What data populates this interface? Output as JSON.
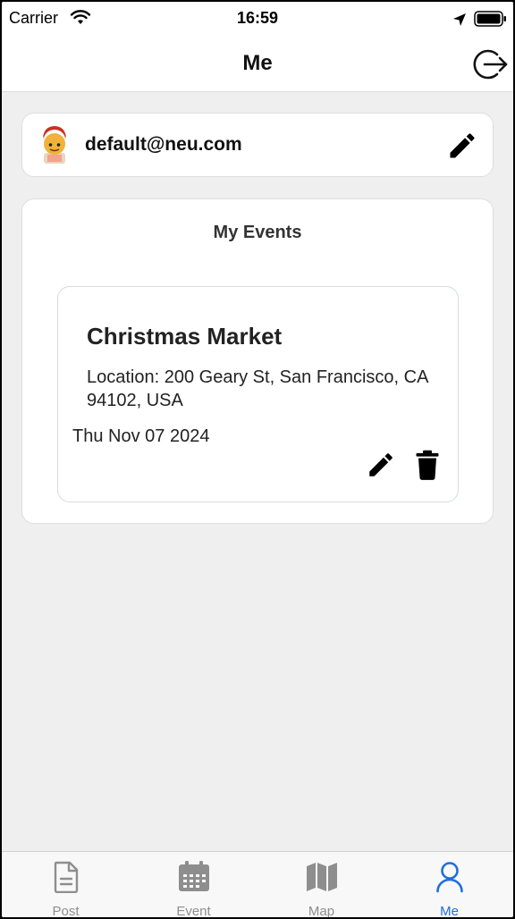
{
  "status_bar": {
    "carrier": "Carrier",
    "time": "16:59"
  },
  "nav": {
    "title": "Me",
    "logout_icon": "logout-icon"
  },
  "profile": {
    "email": "default@neu.com",
    "avatar_icon": "avatar-icon",
    "edit_icon": "pencil-icon"
  },
  "events_section": {
    "title": "My Events",
    "events": [
      {
        "name": "Christmas Market",
        "location": "Location: 200 Geary St, San Francisco, CA 94102, USA",
        "date": "Thu Nov 07 2024"
      }
    ]
  },
  "tab_bar": {
    "items": [
      {
        "label": "Post",
        "icon": "document-icon",
        "active": false
      },
      {
        "label": "Event",
        "icon": "calendar-icon",
        "active": false
      },
      {
        "label": "Map",
        "icon": "map-icon",
        "active": false
      },
      {
        "label": "Me",
        "icon": "person-icon",
        "active": true
      }
    ]
  },
  "colors": {
    "accent": "#1f6fd9",
    "background": "#efefef",
    "inactive_tab": "#8e8e8e"
  }
}
